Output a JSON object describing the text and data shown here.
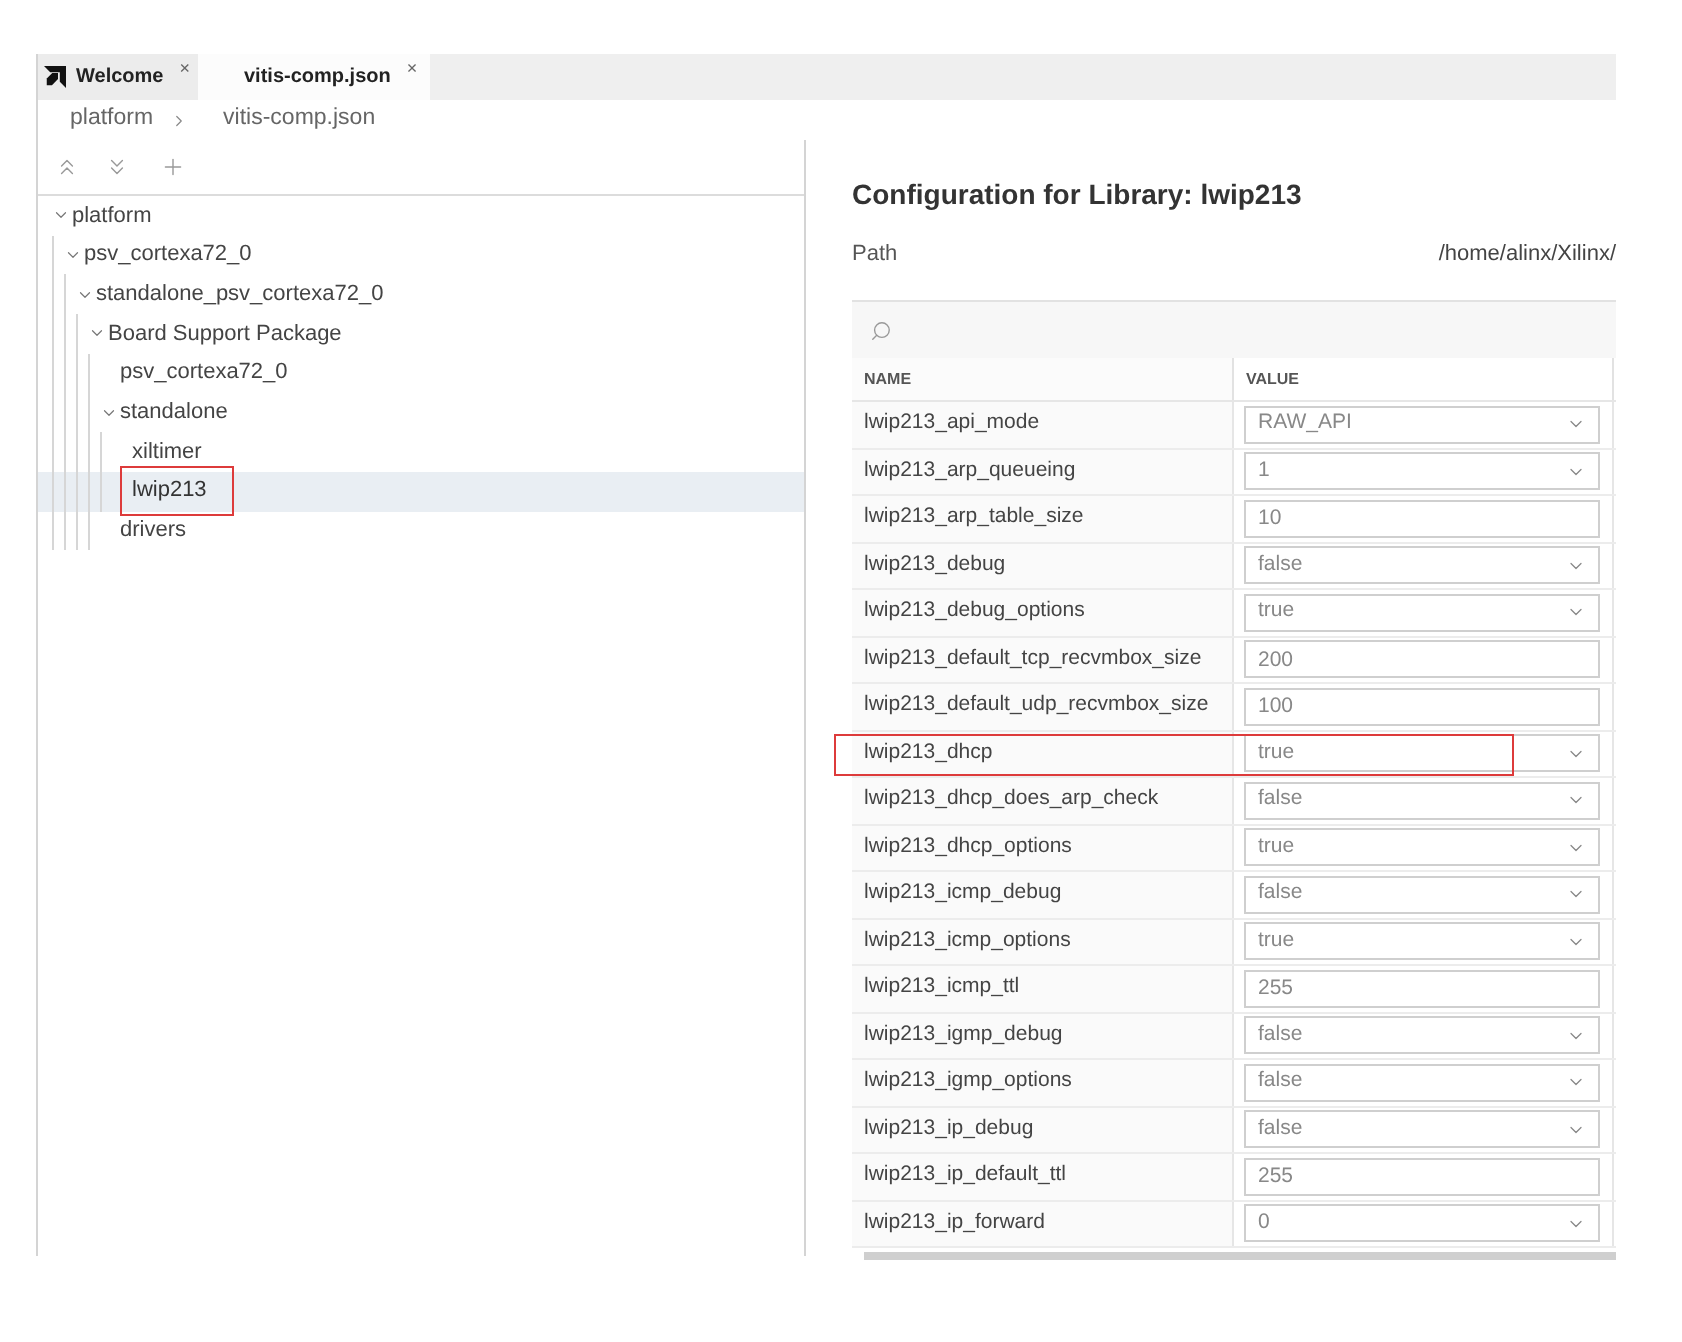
{
  "tabs": [
    {
      "label": "Welcome",
      "close": "×",
      "logo": true,
      "selected": false
    },
    {
      "label": "vitis-comp.json",
      "close": "×",
      "logo": false,
      "selected": true
    }
  ],
  "breadcrumb": [
    "platform",
    "vitis-comp.json"
  ],
  "tree": [
    {
      "label": "platform",
      "expanded": true,
      "selected": false,
      "highlighted": false,
      "children": [
        {
          "label": "psv_cortexa72_0",
          "expanded": true,
          "selected": false,
          "highlighted": false,
          "children": [
            {
              "label": "standalone_psv_cortexa72_0",
              "expanded": true,
              "selected": false,
              "highlighted": false,
              "children": [
                {
                  "label": "Board Support Package",
                  "expanded": true,
                  "selected": false,
                  "highlighted": false,
                  "children": [
                    {
                      "label": "psv_cortexa72_0",
                      "selected": false,
                      "highlighted": false
                    },
                    {
                      "label": "standalone",
                      "expanded": true,
                      "selected": false,
                      "highlighted": false,
                      "children": [
                        {
                          "label": "xiltimer",
                          "selected": false,
                          "highlighted": false
                        },
                        {
                          "label": "lwip213",
                          "selected": true,
                          "highlighted": true
                        }
                      ]
                    },
                    {
                      "label": "drivers",
                      "selected": false,
                      "highlighted": false
                    }
                  ]
                }
              ]
            }
          ]
        }
      ]
    }
  ],
  "config": {
    "title": "Configuration for Library: lwip213",
    "path_label": "Path",
    "path_value": "/home/alinx/Xilinx/",
    "columns": [
      "NAME",
      "VALUE"
    ],
    "rows": [
      {
        "name": "lwip213_api_mode",
        "kind": "select",
        "value": "RAW_API",
        "highlighted": false
      },
      {
        "name": "lwip213_arp_queueing",
        "kind": "select",
        "value": "1",
        "highlighted": false
      },
      {
        "name": "lwip213_arp_table_size",
        "kind": "text",
        "value": "10",
        "highlighted": false
      },
      {
        "name": "lwip213_debug",
        "kind": "select",
        "value": "false",
        "highlighted": false
      },
      {
        "name": "lwip213_debug_options",
        "kind": "select",
        "value": "true",
        "highlighted": false
      },
      {
        "name": "lwip213_default_tcp_recvmbox_size",
        "kind": "text",
        "value": "200",
        "highlighted": false
      },
      {
        "name": "lwip213_default_udp_recvmbox_size",
        "kind": "text",
        "value": "100",
        "highlighted": false
      },
      {
        "name": "lwip213_dhcp",
        "kind": "select",
        "value": "true",
        "highlighted": true
      },
      {
        "name": "lwip213_dhcp_does_arp_check",
        "kind": "select",
        "value": "false",
        "highlighted": false
      },
      {
        "name": "lwip213_dhcp_options",
        "kind": "select",
        "value": "true",
        "highlighted": false
      },
      {
        "name": "lwip213_icmp_debug",
        "kind": "select",
        "value": "false",
        "highlighted": false
      },
      {
        "name": "lwip213_icmp_options",
        "kind": "select",
        "value": "true",
        "highlighted": false
      },
      {
        "name": "lwip213_icmp_ttl",
        "kind": "text",
        "value": "255",
        "highlighted": false
      },
      {
        "name": "lwip213_igmp_debug",
        "kind": "select",
        "value": "false",
        "highlighted": false
      },
      {
        "name": "lwip213_igmp_options",
        "kind": "select",
        "value": "false",
        "highlighted": false
      },
      {
        "name": "lwip213_ip_debug",
        "kind": "select",
        "value": "false",
        "highlighted": false
      },
      {
        "name": "lwip213_ip_default_ttl",
        "kind": "text",
        "value": "255",
        "highlighted": false
      },
      {
        "name": "lwip213_ip_forward",
        "kind": "select",
        "value": "0",
        "highlighted": false
      }
    ]
  }
}
